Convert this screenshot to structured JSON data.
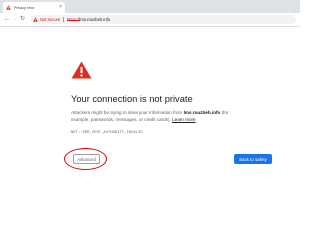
{
  "browser": {
    "tab": {
      "title": "Privacy error",
      "close": "×"
    },
    "nav": {
      "back": "←",
      "forward": "→",
      "reload": "↻"
    },
    "omnibox": {
      "security_label": "Not secure",
      "url_scheme": "https://",
      "url_host": "lms.rouzbeh.info"
    }
  },
  "page": {
    "heading": "Your connection is not private",
    "body_before": "Attackers might be trying to steal your information from ",
    "body_host": "lms.rouzbeh.info",
    "body_after": " (for example, passwords, messages, or credit cards). ",
    "learn_more": "Learn more",
    "error_code": "NET::ERR_CERT_AUTHORITY_INVALID",
    "advanced_button": "Advanced",
    "back_button": "Back to safety"
  },
  "colors": {
    "danger_red": "#d93025",
    "annotation_red": "#d50000",
    "primary_blue": "#1a73e8"
  }
}
